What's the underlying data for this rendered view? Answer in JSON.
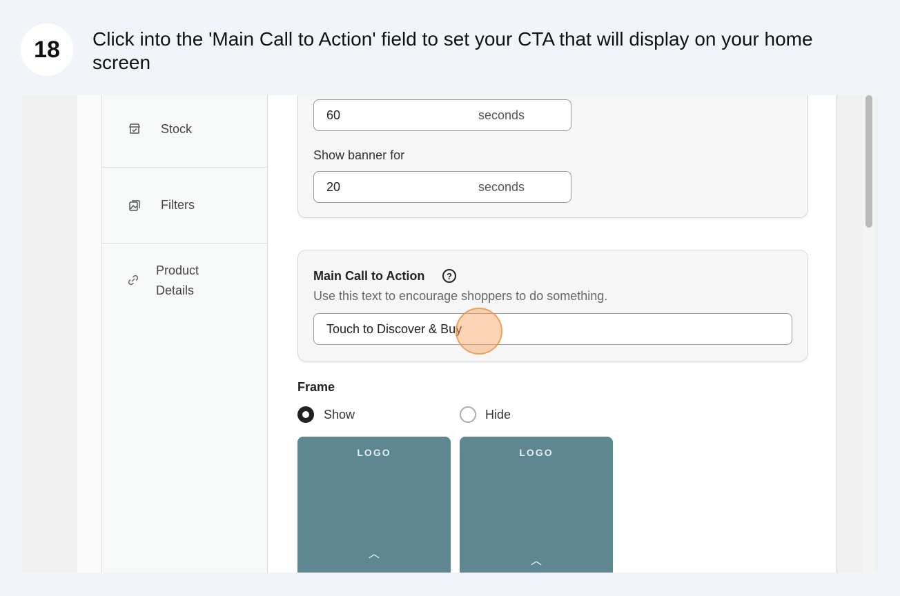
{
  "step": {
    "number": "18",
    "instruction": "Click into the 'Main Call to Action' field to set your CTA that will display on your home screen"
  },
  "sidebar": {
    "items": [
      {
        "label": "Stock",
        "icon": "store-check-icon"
      },
      {
        "label": "Filters",
        "icon": "image-filter-icon"
      },
      {
        "label": "Product Details",
        "icon": "link-icon"
      }
    ]
  },
  "timing": {
    "first_value": "60",
    "first_unit": "seconds",
    "show_banner_label": "Show banner for",
    "banner_value": "20",
    "banner_unit": "seconds"
  },
  "cta": {
    "title": "Main Call to Action",
    "help_glyph": "?",
    "description": "Use this text to encourage shoppers to do something.",
    "value": "Touch to Discover & Buy"
  },
  "frame": {
    "title": "Frame",
    "options": [
      {
        "label": "Show",
        "selected": true
      },
      {
        "label": "Hide",
        "selected": false
      }
    ],
    "previews": [
      {
        "logo": "LOGO",
        "chevron": "︿"
      },
      {
        "logo": "LOGO",
        "chevron": "︿"
      }
    ]
  },
  "colors": {
    "accent_marker": "#f4a05a",
    "preview_bg": "#5f8792"
  }
}
